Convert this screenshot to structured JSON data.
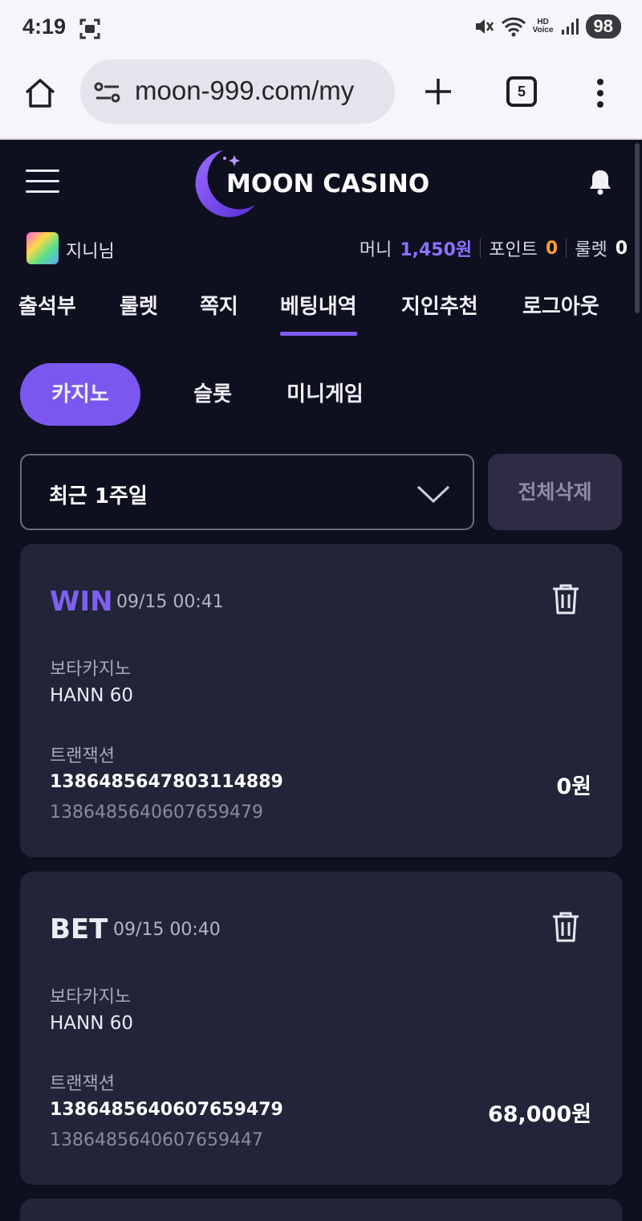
{
  "status_bar": {
    "time": "4:19",
    "hd_line1": "HD",
    "hd_line2": "Voice",
    "battery": "98"
  },
  "browser": {
    "url": "moon-999.com/my",
    "tab_count": "5"
  },
  "site": {
    "logo_text": "MOON CASINO",
    "accent_color": "#7b57f0"
  },
  "user": {
    "name": "지니님",
    "money_label": "머니",
    "money_value": "1,450원",
    "point_label": "포인트",
    "point_value": "0",
    "roulette_label": "룰렛",
    "roulette_value": "0"
  },
  "nav": {
    "tabs": [
      {
        "label": "출석부"
      },
      {
        "label": "룰렛"
      },
      {
        "label": "쪽지"
      },
      {
        "label": "베팅내역"
      },
      {
        "label": "지인추천"
      },
      {
        "label": "로그아웃"
      }
    ],
    "active_index": 3
  },
  "subtabs": {
    "items": [
      {
        "label": "카지노"
      },
      {
        "label": "슬롯"
      },
      {
        "label": "미니게임"
      }
    ],
    "active_index": 0
  },
  "filter": {
    "period": "최근 1주일",
    "delete_all": "전체삭제"
  },
  "records": [
    {
      "status": "WIN",
      "status_color": "#8060f2",
      "datetime": "09/15 00:41",
      "provider": "보타카지노",
      "game": "HANN 60",
      "tx_label": "트랜잭션",
      "tx_id": "1386485647803114889",
      "tx_ref": "1386485640607659479",
      "amount": "0원"
    },
    {
      "status": "BET",
      "status_color": "#ececf4",
      "datetime": "09/15 00:40",
      "provider": "보타카지노",
      "game": "HANN 60",
      "tx_label": "트랜잭션",
      "tx_id": "1386485640607659479",
      "tx_ref": "1386485640607659447",
      "amount": "68,000원"
    }
  ]
}
